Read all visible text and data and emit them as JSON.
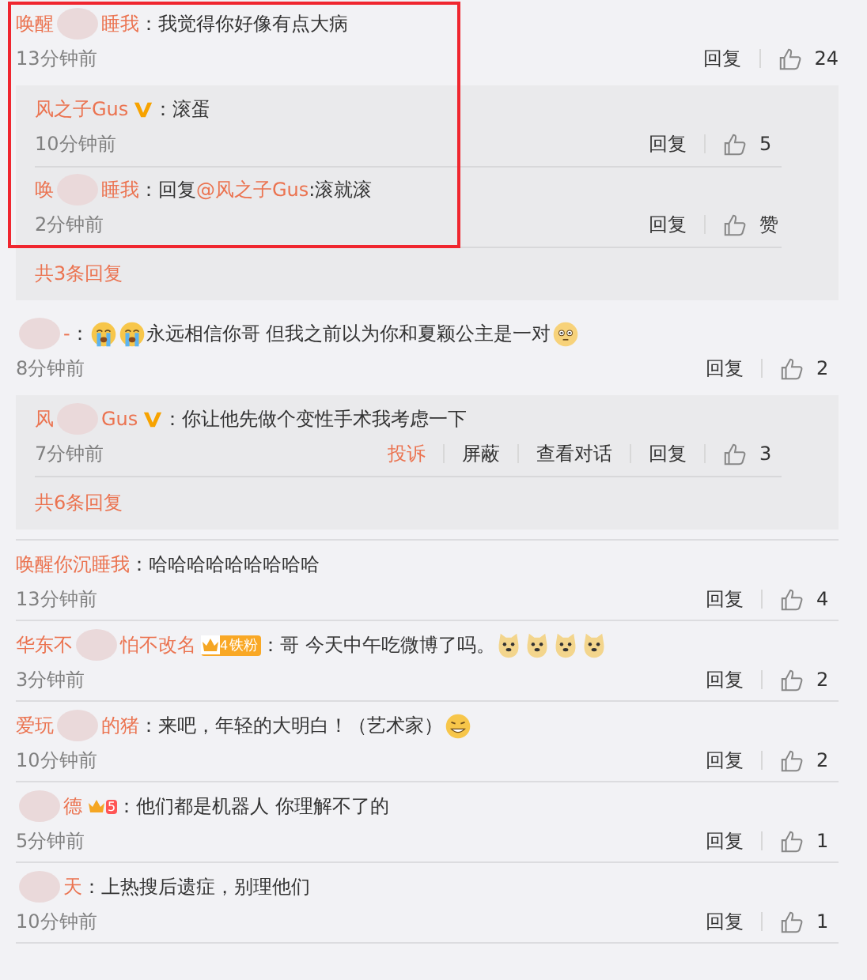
{
  "comments": [
    {
      "highlight": true,
      "name": [
        {
          "kind": "text",
          "text": "唤醒"
        },
        {
          "kind": "redacted"
        },
        {
          "kind": "text",
          "text": "睡我"
        }
      ],
      "colon": "：",
      "content": [
        {
          "kind": "text",
          "text": "我觉得你好像有点大病"
        }
      ],
      "time": "13分钟前",
      "actions": [
        {
          "label": "回复"
        }
      ],
      "likes": "24",
      "replies": [
        {
          "name": [
            {
              "kind": "text",
              "text": "风之子Gus"
            }
          ],
          "badge": {
            "kind": "verified"
          },
          "colon": "：",
          "content": [
            {
              "kind": "text",
              "text": "滚蛋"
            }
          ],
          "time": "10分钟前",
          "actions": [
            {
              "label": "回复"
            }
          ],
          "likes": "5"
        },
        {
          "name": [
            {
              "kind": "text",
              "text": "唤"
            },
            {
              "kind": "redacted"
            },
            {
              "kind": "text",
              "text": "睡我"
            }
          ],
          "colon": "：",
          "content": [
            {
              "kind": "text",
              "text": "回复"
            },
            {
              "kind": "mention",
              "text": "@风之子Gus"
            },
            {
              "kind": "text",
              "text": ":滚就滚"
            }
          ],
          "time": "2分钟前",
          "actions": [
            {
              "label": "回复"
            }
          ],
          "likes": "赞"
        }
      ],
      "more": "共3条回复"
    },
    {
      "name": [
        {
          "kind": "redacted"
        },
        {
          "kind": "text",
          "text": "-"
        }
      ],
      "colon": "：",
      "content": [
        {
          "kind": "cry"
        },
        {
          "kind": "cry"
        },
        {
          "kind": "text",
          "text": "永远相信你哥 但我之前以为你和夏颖公主是一对"
        },
        {
          "kind": "blush"
        }
      ],
      "time": "8分钟前",
      "actions": [
        {
          "label": "回复"
        }
      ],
      "likes": "2",
      "replies": [
        {
          "name": [
            {
              "kind": "text",
              "text": "风"
            },
            {
              "kind": "redacted"
            },
            {
              "kind": "text",
              "text": "Gus"
            }
          ],
          "badge": {
            "kind": "verified"
          },
          "colon": "：",
          "content": [
            {
              "kind": "text",
              "text": "你让他先做个变性手术我考虑一下"
            }
          ],
          "time": "7分钟前",
          "actions": [
            {
              "kind": "report",
              "label": "投诉"
            },
            {
              "label": "屏蔽"
            },
            {
              "label": "查看对话"
            },
            {
              "label": "回复"
            }
          ],
          "likes": "3"
        }
      ],
      "more": "共6条回复"
    },
    {
      "name": [
        {
          "kind": "text",
          "text": "唤醒你沉睡我"
        }
      ],
      "colon": "：",
      "content": [
        {
          "kind": "text",
          "text": "哈哈哈哈哈哈哈哈哈"
        }
      ],
      "time": "13分钟前",
      "actions": [
        {
          "label": "回复"
        }
      ],
      "likes": "4"
    },
    {
      "name": [
        {
          "kind": "text",
          "text": "华东不"
        },
        {
          "kind": "redacted"
        },
        {
          "kind": "text",
          "text": "怕不改名"
        }
      ],
      "badge": {
        "kind": "fan",
        "level": "4",
        "label": "铁粉"
      },
      "colon": "：",
      "content": [
        {
          "kind": "text",
          "text": "哥 今天中午吃微博了吗。"
        },
        {
          "kind": "doge"
        },
        {
          "kind": "doge"
        },
        {
          "kind": "doge"
        },
        {
          "kind": "doge"
        }
      ],
      "time": "3分钟前",
      "actions": [
        {
          "label": "回复"
        }
      ],
      "likes": "2"
    },
    {
      "name": [
        {
          "kind": "text",
          "text": "爱玩"
        },
        {
          "kind": "redacted"
        },
        {
          "kind": "text",
          "text": "的猪"
        }
      ],
      "colon": "：",
      "content": [
        {
          "kind": "text",
          "text": "来吧，年轻的大明白！（艺术家）"
        },
        {
          "kind": "grin"
        }
      ],
      "time": "10分钟前",
      "actions": [
        {
          "label": "回复"
        }
      ],
      "likes": "2"
    },
    {
      "name": [
        {
          "kind": "redacted"
        },
        {
          "kind": "text",
          "text": "德"
        }
      ],
      "badge": {
        "kind": "crown",
        "level": "5"
      },
      "colon": "：",
      "content": [
        {
          "kind": "text",
          "text": "他们都是机器人 你理解不了的"
        }
      ],
      "time": "5分钟前",
      "actions": [
        {
          "label": "回复"
        }
      ],
      "likes": "1"
    },
    {
      "name": [
        {
          "kind": "redacted"
        },
        {
          "kind": "text",
          "text": "天"
        }
      ],
      "colon": "：",
      "content": [
        {
          "kind": "text",
          "text": "上热搜后遗症，别理他们"
        }
      ],
      "time": "10分钟前",
      "actions": [
        {
          "label": "回复"
        }
      ],
      "likes": "1"
    }
  ]
}
